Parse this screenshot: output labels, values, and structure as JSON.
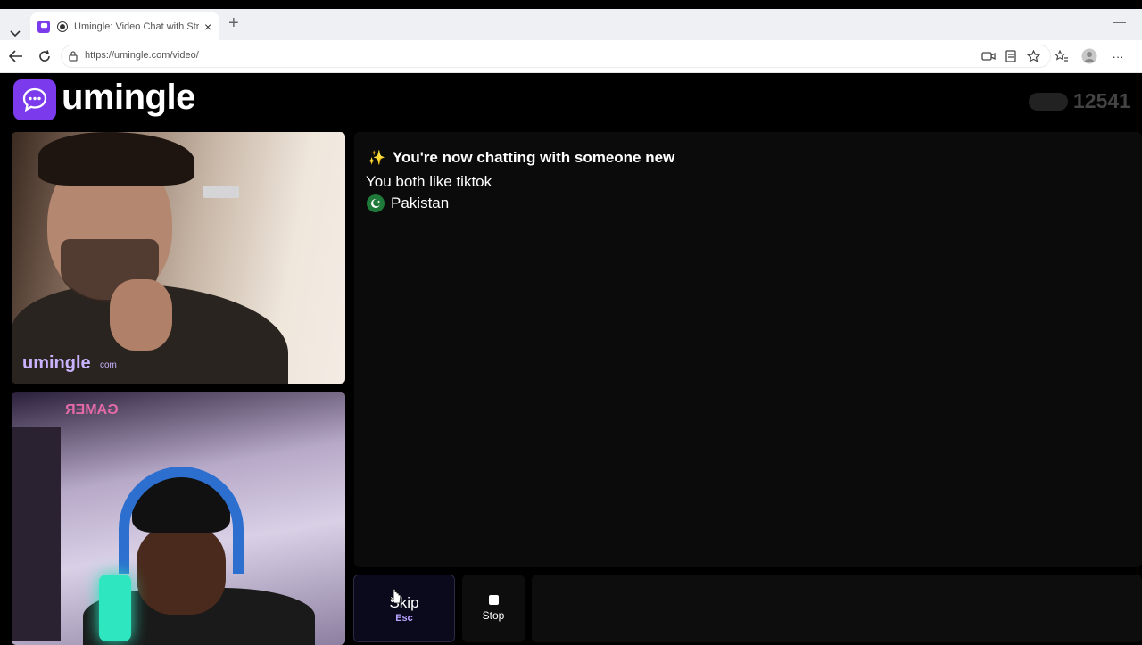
{
  "browser": {
    "tab_title": "Umingle: Video Chat with Stra",
    "url": "https://umingle.com/video/",
    "new_tab_symbol": "+",
    "close_symbol": "×",
    "minimize_symbol": "—",
    "menu_symbol": "···"
  },
  "app": {
    "brand": "umingle",
    "online_count": "12541",
    "brand_color": "#7c3aed"
  },
  "videos": {
    "watermark_brand": "umingle",
    "watermark_sub": "com"
  },
  "chat": {
    "new_chat_text": "You're now chatting with someone new",
    "sparkle": "✨",
    "common_interest": "You both like tiktok",
    "country": "Pakistan"
  },
  "controls": {
    "skip_label": "Skip",
    "skip_key": "Esc",
    "stop_label": "Stop"
  }
}
